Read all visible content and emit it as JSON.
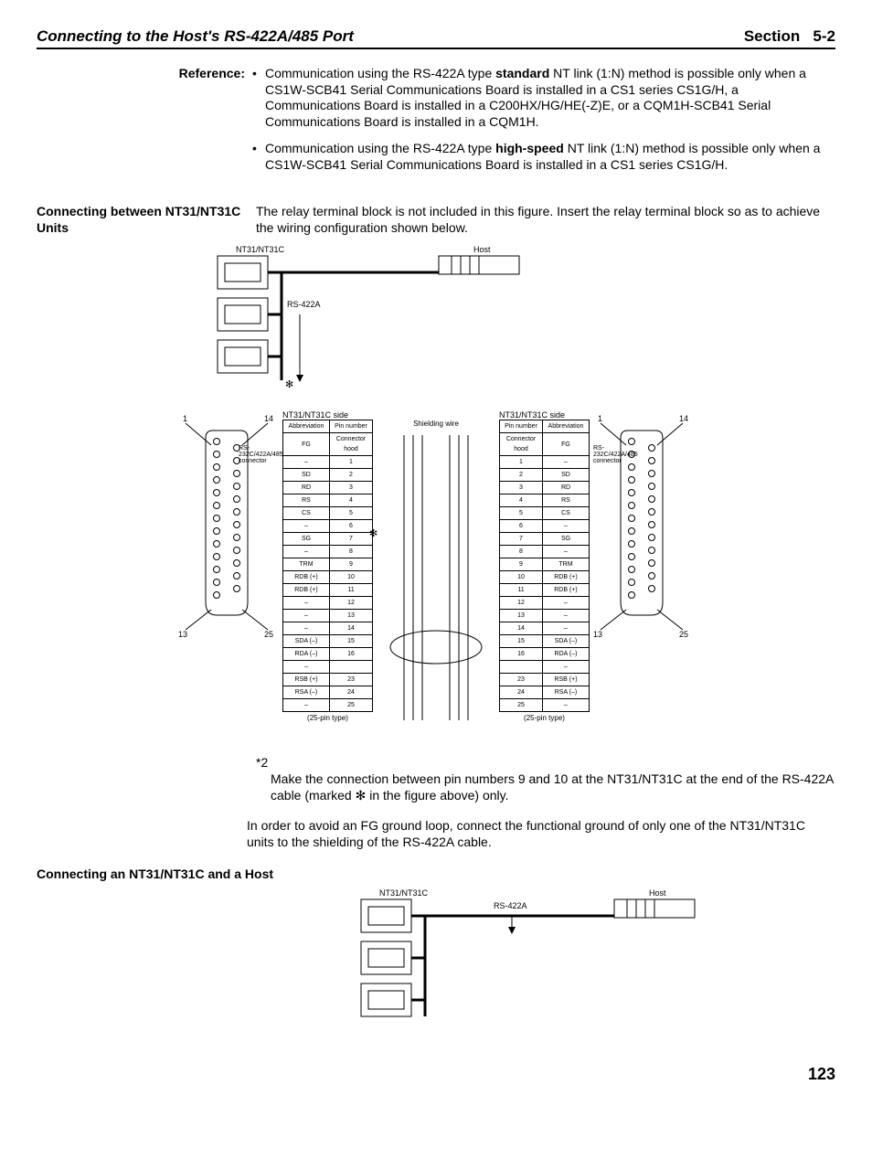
{
  "header": {
    "left": "Connecting to the Host's RS-422A/485 Port",
    "right_label": "Section",
    "right_num": "5-2"
  },
  "reference": {
    "label": "Reference:",
    "bullets": [
      {
        "parts": [
          {
            "t": "Communication using the RS-422A type "
          },
          {
            "t": "standard",
            "b": true
          },
          {
            "t": " NT link (1:N) method is possible only when a CS1W-SCB41 Serial Communications Board is installed in a CS1 series CS1G/H, a Communications Board is installed in a C200HX/HG/HE(-Z)E, or a CQM1H-SCB41 Serial Communications Board is installed in a CQM1H."
          }
        ]
      },
      {
        "parts": [
          {
            "t": "Communication using the RS-422A type "
          },
          {
            "t": "high-speed",
            "b": true
          },
          {
            "t": " NT link (1:N) method is possible only when a CS1W-SCB41 Serial Communications Board is installed in a CS1 series CS1G/H."
          }
        ]
      }
    ]
  },
  "section1": {
    "heading": "Connecting between NT31/NT31C Units",
    "body": "The relay terminal block is not included in this figure. Insert the relay terminal block so as to achieve the wiring configuration shown below."
  },
  "diagram1": {
    "nt_label": "NT31/NT31C",
    "host_label": "Host",
    "bus_label": "RS-422A",
    "star": "✻"
  },
  "pin_diagram": {
    "left_side": "NT31/NT31C side",
    "right_side": "NT31/NT31C side",
    "conn_label": "RS-232C/422A/485 connector",
    "shield_label": "Shielding wire",
    "star": "✻",
    "type_label": "(25-pin type)",
    "col_a": "Abbreviation",
    "col_p": "Pin number",
    "pins": [
      {
        "a": "FG",
        "p": "Connector hood"
      },
      {
        "a": "–",
        "p": "1"
      },
      {
        "a": "SD",
        "p": "2"
      },
      {
        "a": "RD",
        "p": "3"
      },
      {
        "a": "RS",
        "p": "4"
      },
      {
        "a": "CS",
        "p": "5"
      },
      {
        "a": "–",
        "p": "6"
      },
      {
        "a": "SG",
        "p": "7"
      },
      {
        "a": "–",
        "p": "8"
      },
      {
        "a": "TRM",
        "p": "9"
      },
      {
        "a": "RDB (+)",
        "p": "10"
      },
      {
        "a": "RDB (+)",
        "p": "11"
      },
      {
        "a": "–",
        "p": "12"
      },
      {
        "a": "–",
        "p": "13"
      },
      {
        "a": "–",
        "p": "14"
      },
      {
        "a": "SDA (–)",
        "p": "15"
      },
      {
        "a": "RDA (–)",
        "p": "16"
      },
      {
        "a": "–",
        "p": ""
      },
      {
        "a": "RSB (+)",
        "p": "23"
      },
      {
        "a": "RSA (–)",
        "p": "24"
      },
      {
        "a": "–",
        "p": "25"
      }
    ],
    "pins_right_extra": [
      {
        "a": "–",
        "p": "–"
      },
      {
        "a": "RSB (+)",
        "p": "23"
      },
      {
        "a": "RSA (–)",
        "p": "24"
      },
      {
        "a": "–",
        "p": "25"
      }
    ],
    "corner_nums": {
      "tl": "1",
      "tr": "14",
      "bl": "13",
      "br": "25"
    }
  },
  "footnote": {
    "num": "*2",
    "text_before": "Make the connection between pin numbers 9 and 10 at the NT31/NT31C at the end of the RS-422A cable (marked ",
    "star": "✻",
    "text_after": " in the figure above) only."
  },
  "fg_para": "In order to avoid an FG ground loop, connect the functional ground of only one of the NT31/NT31C units to the shielding of the RS-422A cable.",
  "section2": {
    "heading": "Connecting an NT31/NT31C and a Host"
  },
  "diagram3": {
    "nt_label": "NT31/NT31C",
    "host_label": "Host",
    "bus_label": "RS-422A"
  },
  "page_number": "123"
}
